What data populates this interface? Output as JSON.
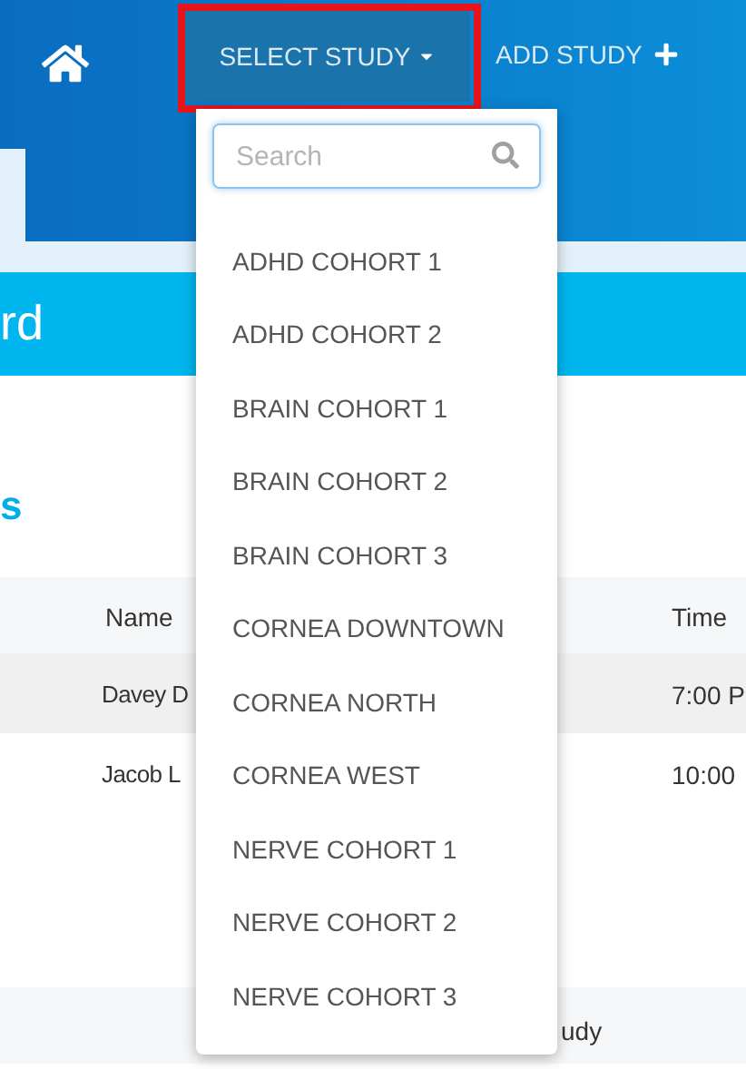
{
  "nav": {
    "select_study": {
      "label": "SELECT STUDY",
      "highlighted": true
    },
    "add_study": {
      "label": "ADD STUDY"
    }
  },
  "banner": {
    "title": "rd"
  },
  "section": {
    "title": "s"
  },
  "table": {
    "columns": [
      "Name",
      "Time"
    ],
    "rows": [
      {
        "name": "Davey D",
        "time": "7:00 P",
        "shaded": true
      },
      {
        "name": "Jacob L",
        "time": "10:00",
        "shaded": false
      }
    ],
    "footer": "udy"
  },
  "dropdown": {
    "search": {
      "placeholder": "Search"
    },
    "items": [
      "ADHD COHORT 1",
      "ADHD COHORT 2",
      "BRAIN COHORT 1",
      "BRAIN COHORT 2",
      "BRAIN COHORT 3",
      "CORNEA DOWNTOWN",
      "CORNEA NORTH",
      "CORNEA WEST",
      "NERVE COHORT 1",
      "NERVE COHORT 2",
      "NERVE COHORT 3"
    ]
  }
}
